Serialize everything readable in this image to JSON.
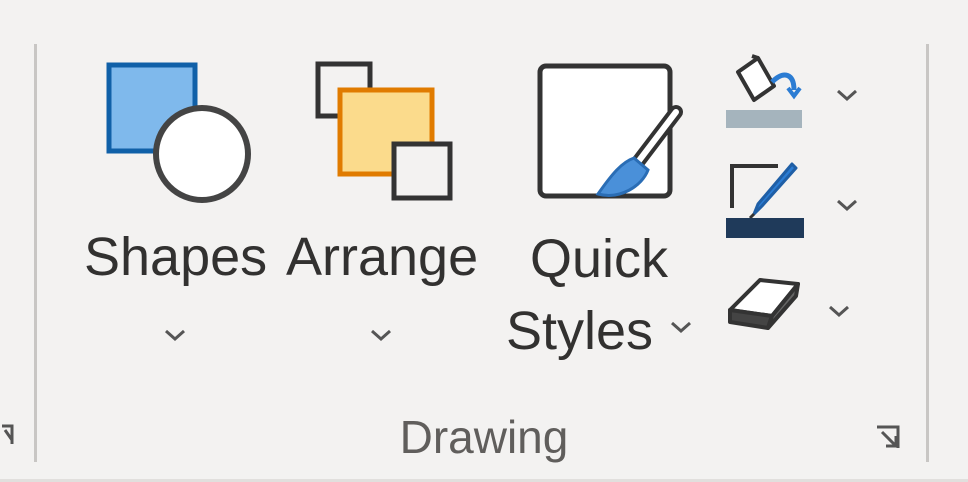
{
  "ribbon": {
    "group": {
      "label": "Drawing"
    },
    "buttons": {
      "shapes": {
        "label": "Shapes",
        "icon": "shapes-icon",
        "colors": {
          "square": "#7fb9ec",
          "square_border": "#1060a8",
          "circle": "#ffffff",
          "circle_border": "#444444"
        }
      },
      "arrange": {
        "label": "Arrange",
        "icon": "arrange-icon",
        "colors": {
          "back": "#fbdb8c",
          "back_border": "#e07b00"
        }
      },
      "quick_styles": {
        "label_line1": "Quick",
        "label_line2": "Styles",
        "icon": "quick-styles-icon",
        "colors": {
          "brush": "#4a90d9"
        }
      },
      "shape_fill": {
        "icon": "paint-bucket-icon",
        "colors": {
          "bar": "#a5b4bd"
        }
      },
      "shape_outline": {
        "icon": "pen-outline-icon",
        "colors": {
          "bar": "#1f3a5a",
          "pen": "#2b7cd3"
        }
      },
      "eraser": {
        "icon": "eraser-icon"
      }
    }
  }
}
